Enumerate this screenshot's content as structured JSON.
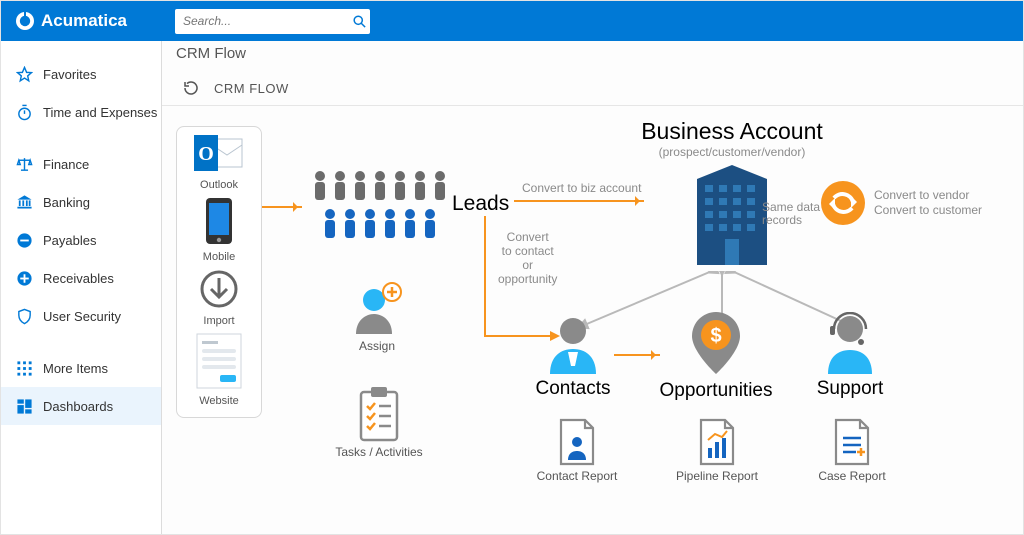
{
  "brand": "Acumatica",
  "search": {
    "placeholder": "Search..."
  },
  "sidebar": {
    "items": [
      {
        "label": "Favorites"
      },
      {
        "label": "Time and Expenses"
      },
      {
        "label": "Finance"
      },
      {
        "label": "Banking"
      },
      {
        "label": "Payables"
      },
      {
        "label": "Receivables"
      },
      {
        "label": "User Security"
      },
      {
        "label": "More Items"
      },
      {
        "label": "Dashboards"
      }
    ]
  },
  "breadcrumb": "CRM Flow",
  "toolbar": {
    "title": "CRM FLOW"
  },
  "sources": {
    "outlook": "Outlook",
    "mobile": "Mobile",
    "import": "Import",
    "website": "Website"
  },
  "nodes": {
    "leads": "Leads",
    "assign": "Assign",
    "tasks": "Tasks / Activities",
    "ba_title": "Business Account",
    "ba_sub": "(prospect/customer/vendor)",
    "contacts": "Contacts",
    "opps": "Opportunities",
    "support": "Support",
    "contact_report": "Contact Report",
    "pipeline_report": "Pipeline Report",
    "case_report": "Case Report"
  },
  "edges": {
    "to_biz": "Convert to biz account",
    "to_contact": "Convert\nto contact\nor\nopportunity",
    "same": "Same data\nrecords",
    "to_vendor": "Convert to vendor",
    "to_customer": "Convert to customer"
  }
}
